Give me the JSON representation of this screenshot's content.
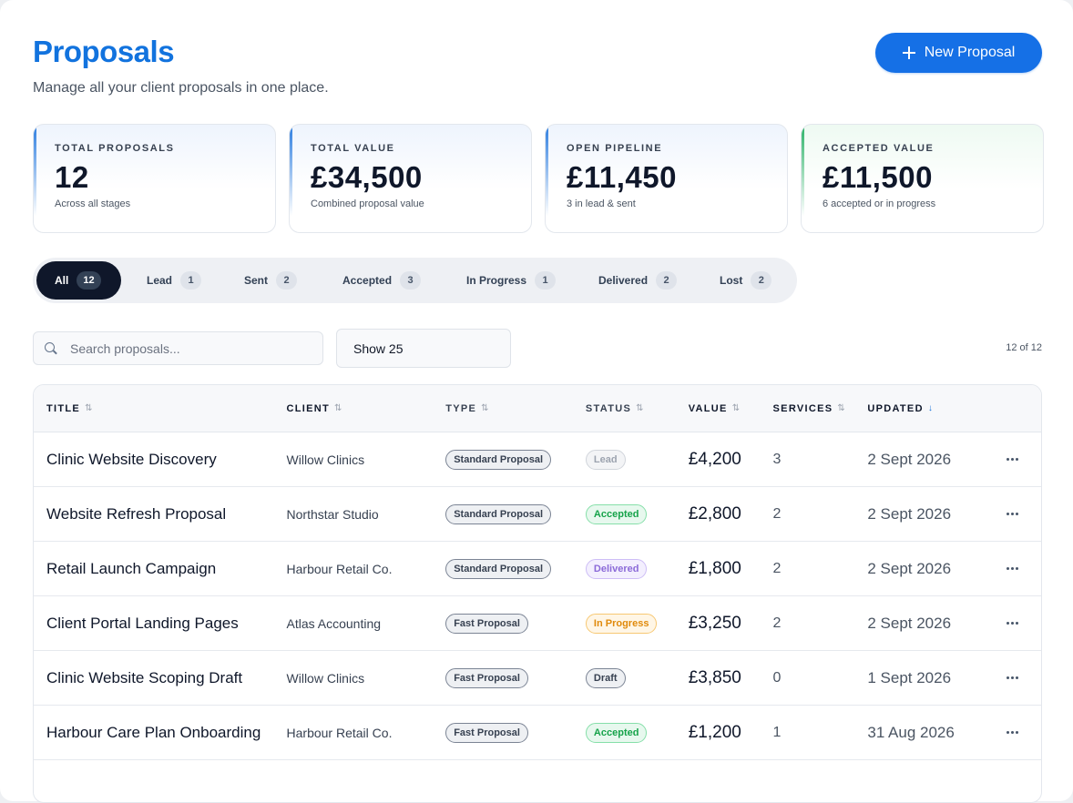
{
  "header": {
    "title": "Proposals",
    "subtitle": "Manage all your client proposals in one place.",
    "new_button": "New Proposal"
  },
  "stats": [
    {
      "label": "TOTAL PROPOSALS",
      "value": "12",
      "note": "Across all stages",
      "accent": "#2f7fe0"
    },
    {
      "label": "TOTAL VALUE",
      "value": "£34,500",
      "note": "Combined proposal value",
      "accent": "#2f7fe0"
    },
    {
      "label": "OPEN PIPELINE",
      "value": "£11,450",
      "note": "3 in lead & sent",
      "accent": "#2f7fe0"
    },
    {
      "label": "ACCEPTED VALUE",
      "value": "£11,500",
      "note": "6 accepted or in progress",
      "accent": "#2fb36a"
    }
  ],
  "filters": [
    {
      "label": "All",
      "count": "12",
      "active": true
    },
    {
      "label": "Lead",
      "count": "1"
    },
    {
      "label": "Sent",
      "count": "2"
    },
    {
      "label": "Accepted",
      "count": "3"
    },
    {
      "label": "In Progress",
      "count": "1"
    },
    {
      "label": "Delivered",
      "count": "2"
    },
    {
      "label": "Lost",
      "count": "2"
    }
  ],
  "search": {
    "placeholder": "Search proposals...",
    "value": ""
  },
  "page_size": {
    "selected": "Show 25"
  },
  "result_count": "12 of 12",
  "table": {
    "columns": {
      "title": "TITLE",
      "client": "CLIENT",
      "type": "TYPE",
      "status": "STATUS",
      "value": "VALUE",
      "services": "SERVICES",
      "updated": "UPDATED"
    },
    "sort_icon": "⇅",
    "sorted_icon": "↓",
    "rows": [
      {
        "title": "Clinic Website Discovery",
        "client": "Willow Clinics",
        "type": "Standard Proposal",
        "status": "Lead",
        "value": "£4,200",
        "services": "3",
        "updated": "2 Sept 2026"
      },
      {
        "title": "Website Refresh Proposal",
        "client": "Northstar Studio",
        "type": "Standard Proposal",
        "status": "Accepted",
        "value": "£2,800",
        "services": "2",
        "updated": "2 Sept 2026"
      },
      {
        "title": "Retail Launch Campaign",
        "client": "Harbour Retail Co.",
        "type": "Standard Proposal",
        "status": "Delivered",
        "value": "£1,800",
        "services": "2",
        "updated": "2 Sept 2026"
      },
      {
        "title": "Client Portal Landing Pages",
        "client": "Atlas Accounting",
        "type": "Fast Proposal",
        "status": "In Progress",
        "value": "£3,250",
        "services": "2",
        "updated": "2 Sept 2026"
      },
      {
        "title": "Clinic Website Scoping Draft",
        "client": "Willow Clinics",
        "type": "Fast Proposal",
        "status": "Draft",
        "value": "£3,850",
        "services": "0",
        "updated": "1 Sept 2026"
      },
      {
        "title": "Harbour Care Plan Onboarding",
        "client": "Harbour Retail Co.",
        "type": "Fast Proposal",
        "status": "Accepted",
        "value": "£1,200",
        "services": "1",
        "updated": "31 Aug 2026"
      }
    ]
  }
}
